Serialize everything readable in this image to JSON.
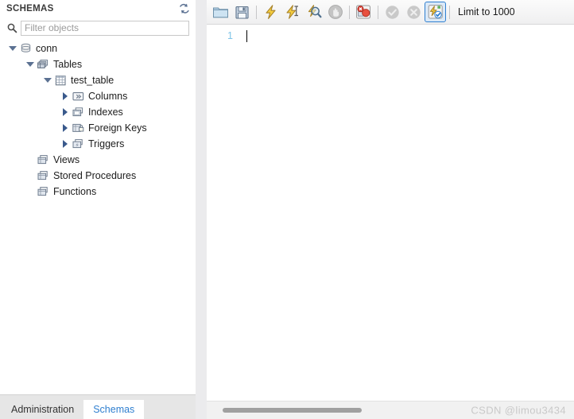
{
  "sidebar": {
    "title": "SCHEMAS",
    "refresh_icon": "refresh-icon",
    "search_icon": "search-icon",
    "filter": {
      "placeholder": "Filter objects",
      "value": ""
    },
    "tree": [
      {
        "label": "conn",
        "icon": "database-icon",
        "depth": 0,
        "expanded": true,
        "has_children": true
      },
      {
        "label": "Tables",
        "icon": "tables-icon",
        "depth": 1,
        "expanded": true,
        "has_children": true
      },
      {
        "label": "test_table",
        "icon": "table-grid-icon",
        "depth": 2,
        "expanded": true,
        "has_children": true
      },
      {
        "label": "Columns",
        "icon": "columns-icon",
        "depth": 3,
        "expanded": false,
        "has_children": true
      },
      {
        "label": "Indexes",
        "icon": "indexes-icon",
        "depth": 3,
        "expanded": false,
        "has_children": true
      },
      {
        "label": "Foreign Keys",
        "icon": "foreign-keys-icon",
        "depth": 3,
        "expanded": false,
        "has_children": true
      },
      {
        "label": "Triggers",
        "icon": "triggers-icon",
        "depth": 3,
        "expanded": false,
        "has_children": true
      },
      {
        "label": "Views",
        "icon": "views-icon",
        "depth": 1,
        "expanded": false,
        "has_children": false
      },
      {
        "label": "Stored Procedures",
        "icon": "procedures-icon",
        "depth": 1,
        "expanded": false,
        "has_children": false
      },
      {
        "label": "Functions",
        "icon": "functions-icon",
        "depth": 1,
        "expanded": false,
        "has_children": false
      }
    ],
    "bottom_tabs": [
      {
        "label": "Administration",
        "active": false
      },
      {
        "label": "Schemas",
        "active": true
      }
    ]
  },
  "toolbar": {
    "buttons": [
      {
        "name": "open-sql-script-button",
        "icon": "folder-icon",
        "selected": false
      },
      {
        "name": "save-sql-script-button",
        "icon": "save-floppy-icon",
        "selected": false
      },
      {
        "name": "execute-statement-button",
        "icon": "lightning-icon",
        "selected": false
      },
      {
        "name": "execute-current-statement-button",
        "icon": "lightning-cursor-icon",
        "selected": false
      },
      {
        "name": "explain-statement-button",
        "icon": "magnifier-lightning-icon",
        "selected": false
      },
      {
        "name": "stop-execution-button",
        "icon": "stop-hand-icon",
        "selected": false
      },
      {
        "name": "toggle-stop-on-error-button",
        "icon": "stop-on-error-icon",
        "selected": false
      },
      {
        "name": "commit-button",
        "icon": "check-circle-icon",
        "selected": false
      },
      {
        "name": "rollback-button",
        "icon": "x-circle-icon",
        "selected": false
      },
      {
        "name": "toggle-autocommit-button",
        "icon": "autocommit-icon",
        "selected": true
      }
    ],
    "limit_label": "Limit to 1000"
  },
  "editor": {
    "line_numbers": [
      "1"
    ],
    "content": ""
  },
  "status": {
    "watermark": "CSDN @limou3434"
  },
  "colors": {
    "accent_blue": "#2f7fd0",
    "line_number": "#7fc4e8",
    "panel_bg": "#ffffff",
    "tabbar_bg": "#e6e6e6",
    "splitter": "#ebebed"
  }
}
